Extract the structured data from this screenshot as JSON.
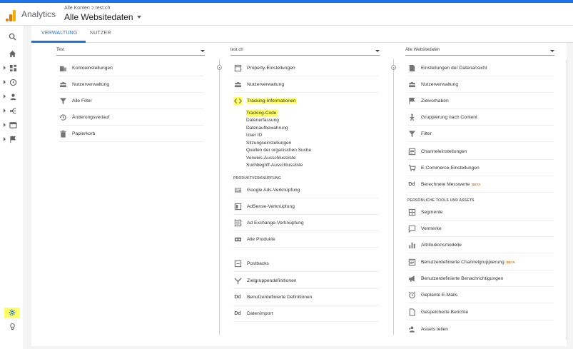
{
  "header": {
    "app_title": "Analytics",
    "breadcrumb": "Alle Konten > test.ch",
    "view_name": "Alle Websitedaten"
  },
  "tabs": [
    {
      "label": "VERWALTUNG"
    },
    {
      "label": "NUTZER"
    }
  ],
  "columns": {
    "account": {
      "selector": "Test",
      "items": [
        {
          "label": "Kontoeinstellungen",
          "icon": "building-icon"
        },
        {
          "label": "Nutzerverwaltung",
          "icon": "people-icon"
        },
        {
          "label": "Alle Filter",
          "icon": "filter-icon"
        },
        {
          "label": "Änderungsverlauf",
          "icon": "history-icon"
        },
        {
          "label": "Papierkorb",
          "icon": "trash-icon"
        }
      ]
    },
    "property": {
      "selector": "test.ch",
      "items_top": [
        {
          "label": "Property-Einstellungen",
          "icon": "property-icon"
        },
        {
          "label": "Nutzerverwaltung",
          "icon": "people-icon"
        },
        {
          "label": "Tracking-Informationen",
          "icon": "code-icon"
        }
      ],
      "tracking_subitems": [
        "Tracking-Code",
        "Datenerfassung",
        "Datenaufbewahrung",
        "User ID",
        "Sitzungseinstellungen",
        "Quellen der organischen Suche",
        "Verweis-Ausschlussliste",
        "Suchbegriff-Ausschlussliste"
      ],
      "section_label": "PRODUKTVERKNÜPFUNG",
      "items_linking": [
        {
          "label": "Google Ads-Verknüpfung",
          "icon": "ads-icon"
        },
        {
          "label": "AdSense-Verknüpfung",
          "icon": "adsense-icon"
        },
        {
          "label": "Ad Exchange-Verknüpfung",
          "icon": "adexchange-icon"
        },
        {
          "label": "Alle Produkte",
          "icon": "products-icon"
        },
        {
          "label": "Postbacks",
          "icon": "postbacks-icon"
        },
        {
          "label": "Zielgruppendefinitionen",
          "icon": "audience-icon"
        },
        {
          "label": "Benutzerdefinierte Definitionen",
          "icon": "dd-icon"
        },
        {
          "label": "Datenimport",
          "icon": "dd-icon"
        }
      ]
    },
    "view": {
      "selector": "Alle Websitedaten",
      "items": [
        {
          "label": "Einstellungen der Datenansicht",
          "icon": "doc-icon"
        },
        {
          "label": "Nutzerverwaltung",
          "icon": "people-icon"
        },
        {
          "label": "Zielvorhaben",
          "icon": "flag-icon"
        },
        {
          "label": "Gruppierung nach Content",
          "icon": "person-walk-icon"
        },
        {
          "label": "Filter",
          "icon": "filter-icon"
        },
        {
          "label": "Channeleinstellungen",
          "icon": "channel-icon"
        },
        {
          "label": "E-Commerce-Einstellungen",
          "icon": "cart-icon"
        },
        {
          "label": "Berechnete Messwerte",
          "icon": "dd-icon",
          "badge": "BETA"
        }
      ],
      "section_label": "PERSÖNLICHE TOOLS UND ASSETS",
      "tools": [
        {
          "label": "Segmente",
          "icon": "segments-icon"
        },
        {
          "label": "Vermerke",
          "icon": "annotation-icon"
        },
        {
          "label": "Attributionsmodelle",
          "icon": "bars-icon"
        },
        {
          "label": "Benutzerdefinierte Channelgruppierung",
          "icon": "channel-icon",
          "badge": "BETA"
        },
        {
          "label": "Benutzerdefinierte Benachrichtigungen",
          "icon": "megaphone-icon"
        },
        {
          "label": "Geplante E-Mails",
          "icon": "alarm-icon"
        },
        {
          "label": "Gespeicherte Berichte",
          "icon": "report-icon"
        },
        {
          "label": "Assets teilen",
          "icon": "share-icon"
        }
      ]
    }
  },
  "colors": {
    "accent": "#1a73e8",
    "highlight": "#ffff66",
    "beta": "#e8710a",
    "logo_orange": "#f9ab00",
    "logo_dark_orange": "#e37400"
  }
}
